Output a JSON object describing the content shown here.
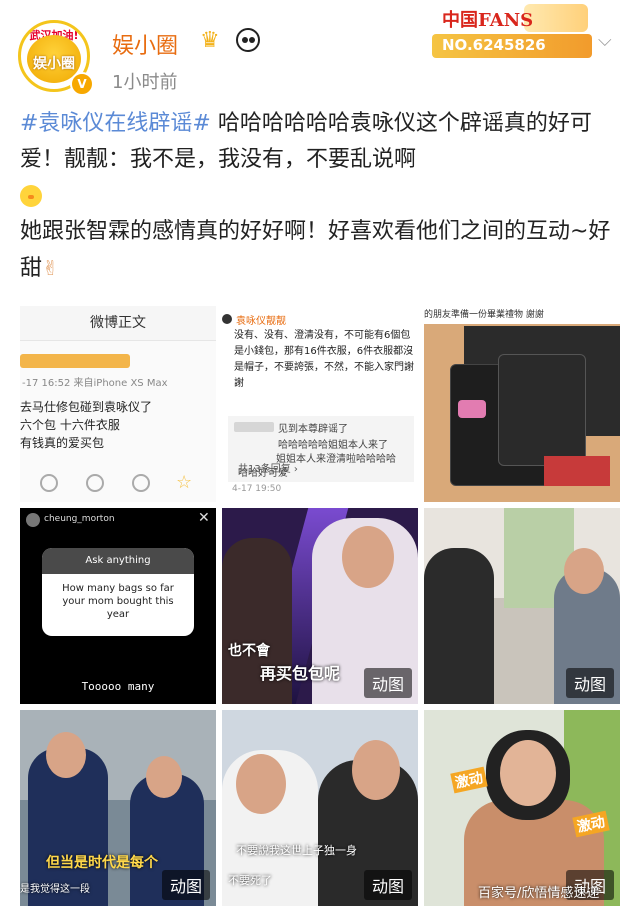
{
  "header": {
    "user_name": "娱小圈",
    "post_time": "1小时前",
    "avatar_top_text": "武汉加油!",
    "avatar_logo_text": "娱小圈",
    "verified_mark": "V",
    "fans_badge_title": "中国FANS",
    "fans_badge_number": "NO.6245826",
    "crown_icon": "crown-icon",
    "panda_icon": "panda-icon"
  },
  "post": {
    "hashtag": "#袁咏仪在线辟谣#",
    "text1": " 哈哈哈哈哈哈袁咏仪这个辟谣真的好可爱！靓靓：我不是，我没有，不要乱说啊",
    "text2": "她跟张智霖的感情真的好好啊！好喜欢看他们之间的互动~好甜"
  },
  "images": {
    "tile1": {
      "header": "微博正文",
      "meta": "-17 16:52  来自iPhone XS Max",
      "line1": "去马仕修包碰到袁咏仪了",
      "line2": "六个包 十六件衣服",
      "line3": "有钱真的爱买包"
    },
    "tile2": {
      "name": "袁咏仪靓靓",
      "text": "没有、没有、澄清没有，不可能有6個包是小錢包，那有16件衣服，6件衣服都沒是帽子，不要誇張，不然，不能入家門謝謝",
      "reply1": "见到本尊辟谣了",
      "reply2": "哈哈哈哈哈姐姐本人来了",
      "reply3": "姐姐本人来澄清啦哈哈哈哈",
      "reply4": "哈哈好可爱",
      "count": "共13条回复 ›",
      "date": "4-17 19:50"
    },
    "tile3": {
      "caption": "的朋友準備一份畢業禮物 謝謝"
    },
    "tile4": {
      "username": "cheung_morton",
      "close": "✕",
      "ask_header": "Ask anything",
      "question": "How many bags so far your mom bought this year",
      "answer": "Tooooo many"
    },
    "tile5": {
      "subtitle1": "也不會",
      "subtitle2": "再买包包呢",
      "badge": "动图"
    },
    "tile6": {
      "badge": "动图"
    },
    "tile7": {
      "subtitle1": "但当是时代是每个",
      "subtitle2": "是我觉得这一段",
      "badge": "动图"
    },
    "tile8": {
      "subtitle1": "不要說我这世上子独一身",
      "subtitle2": "不要死了",
      "badge": "动图"
    },
    "tile9": {
      "sticker1": "激动",
      "sticker2": "激动",
      "badge": "动图"
    }
  },
  "watermark": "百家号/欣悟情感速递",
  "colors": {
    "username": "#e86c10",
    "hashtag": "#5b8ad6",
    "time": "#8a8a8a"
  }
}
